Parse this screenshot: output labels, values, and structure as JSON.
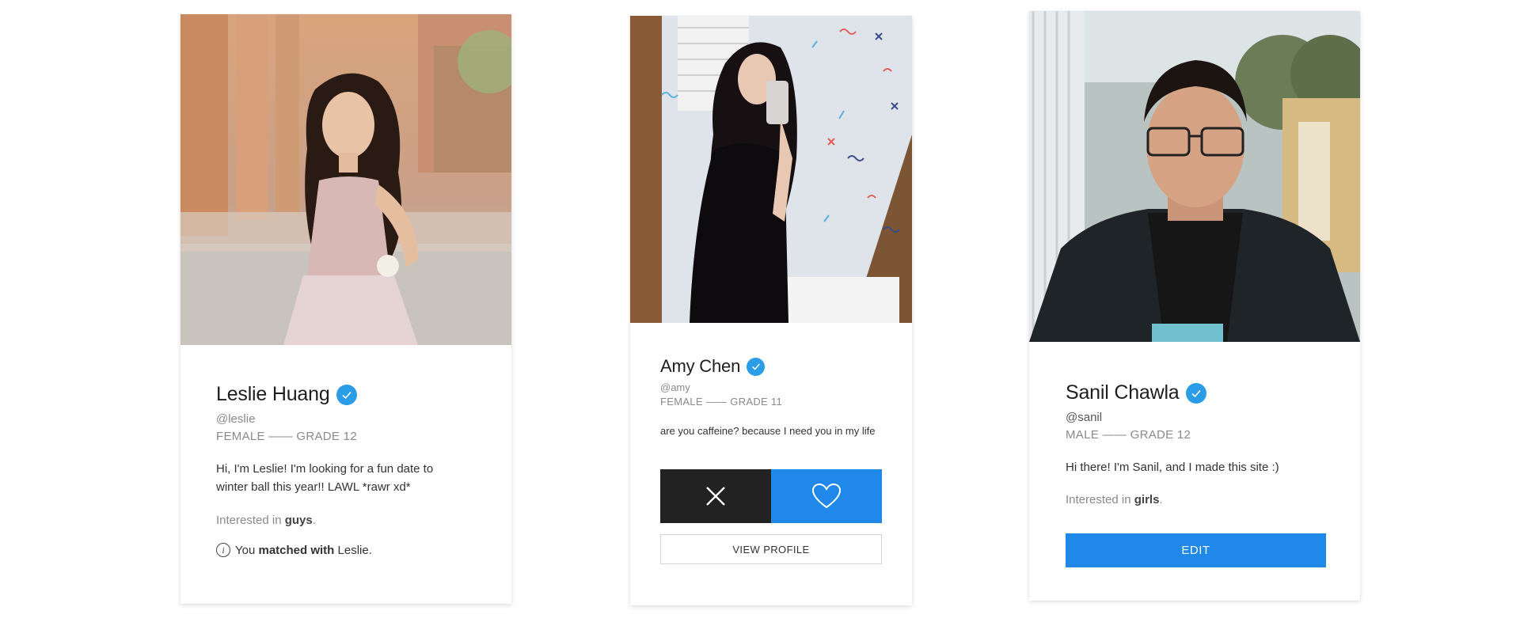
{
  "cards": [
    {
      "name": "Leslie Huang",
      "handle": "@leslie",
      "gender": "FEMALE",
      "grade": "GRADE 12",
      "separator": "——",
      "bio": "Hi, I'm Leslie! I'm looking for a fun date to winter ball this year!! LAWL *rawr xd*",
      "interest_prefix": "Interested in",
      "interest_value": "guys",
      "interest_suffix": ".",
      "match": {
        "icon": "info-icon",
        "prefix": "You",
        "bold": "matched with",
        "suffix": "Leslie."
      },
      "verified_icon": "verified-check-icon",
      "photo_icon": "profile-photo"
    },
    {
      "name": "Amy Chen",
      "handle": "@amy",
      "gender": "FEMALE",
      "grade": "GRADE 11",
      "separator": "——",
      "bio": "are you caffeine? because I need you in my life",
      "pass_icon": "close-icon",
      "like_icon": "heart-icon",
      "view_profile_label": "VIEW PROFILE",
      "verified_icon": "verified-check-icon",
      "photo_icon": "profile-photo"
    },
    {
      "name": "Sanil Chawla",
      "handle": "@sanil",
      "gender": "MALE",
      "grade": "GRADE 12",
      "separator": "——",
      "bio": "Hi there! I'm Sanil, and I made this site :)",
      "interest_prefix": "Interested in",
      "interest_value": "girls",
      "interest_suffix": ".",
      "edit_label": "EDIT",
      "verified_icon": "verified-check-icon",
      "photo_icon": "profile-photo"
    }
  ],
  "colors": {
    "accent_blue": "#1f88e9",
    "verified_blue": "#2a9ce8",
    "pass_dark": "#222222",
    "muted_text": "#8a8a8a"
  }
}
